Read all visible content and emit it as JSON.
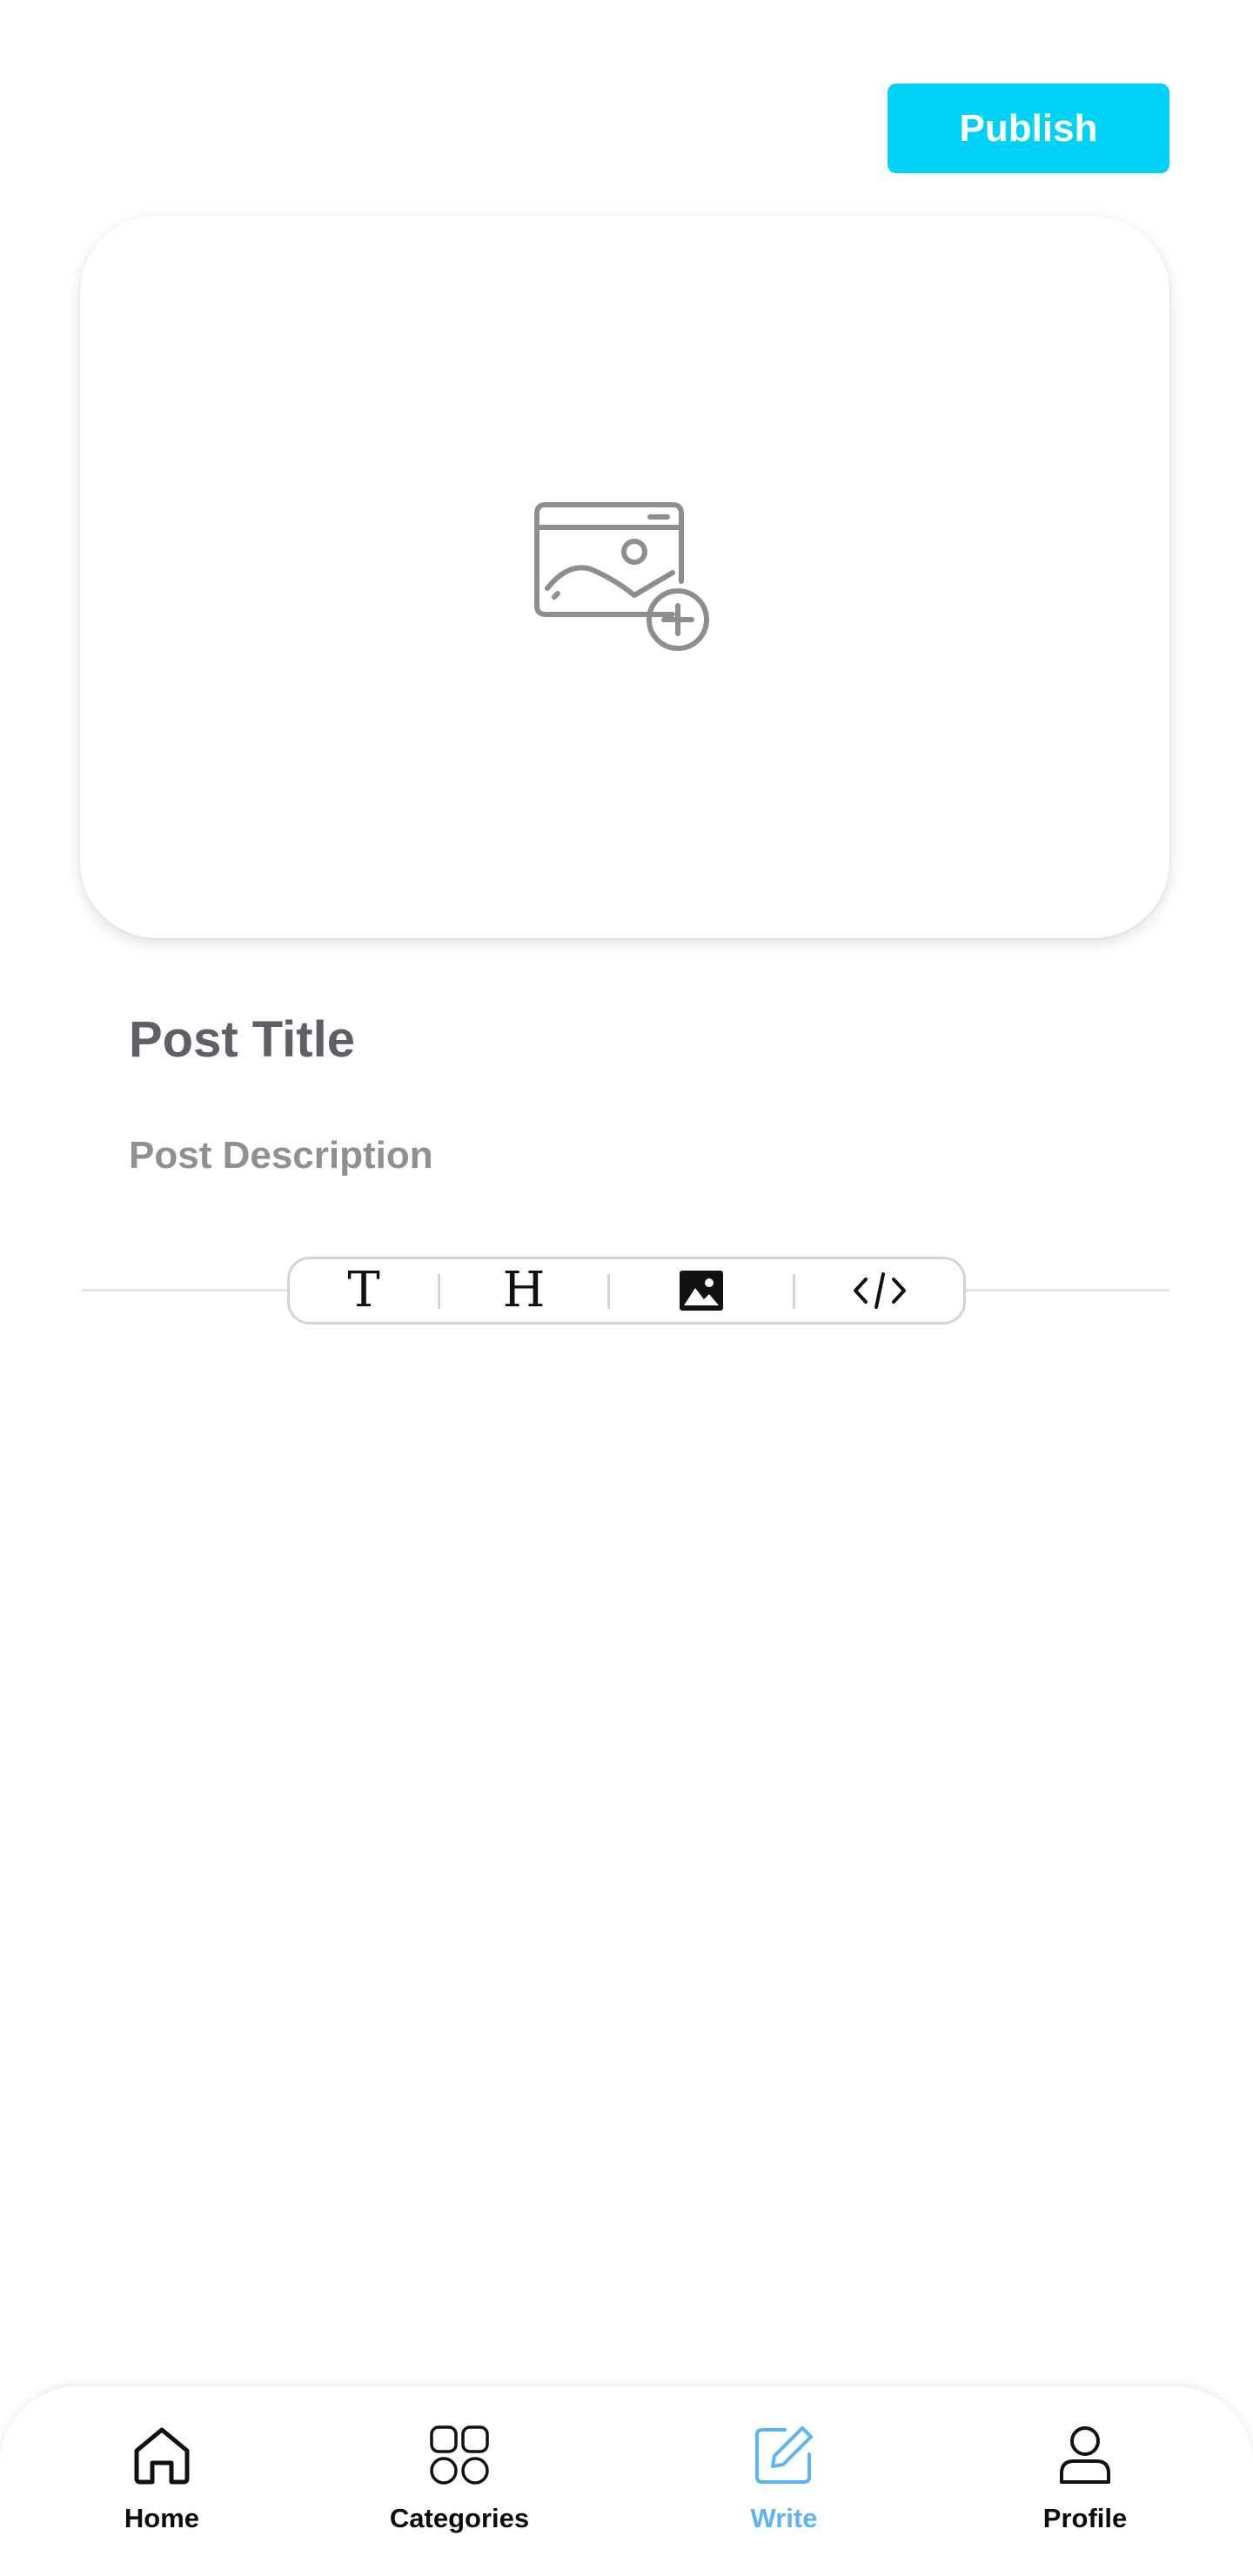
{
  "header": {
    "publish_label": "Publish"
  },
  "cover": {
    "icon": "image-add-icon"
  },
  "editor": {
    "title_placeholder": "Post Title",
    "description_placeholder": "Post Description"
  },
  "toolbar": {
    "items": [
      {
        "name": "text-tool",
        "icon": "T"
      },
      {
        "name": "heading-tool",
        "icon": "H"
      },
      {
        "name": "image-tool",
        "icon": "image-icon"
      },
      {
        "name": "code-tool",
        "icon": "</>"
      }
    ]
  },
  "bottom_nav": {
    "items": [
      {
        "label": "Home",
        "icon": "home-icon",
        "active": false
      },
      {
        "label": "Categories",
        "icon": "grid-icon",
        "active": false
      },
      {
        "label": "Write",
        "icon": "edit-icon",
        "active": true
      },
      {
        "label": "Profile",
        "icon": "user-icon",
        "active": false
      }
    ]
  },
  "colors": {
    "accent": "#00d2f7",
    "active_nav": "#5eb4ef",
    "title_text": "#5f6066",
    "description_text": "#8f9094"
  }
}
